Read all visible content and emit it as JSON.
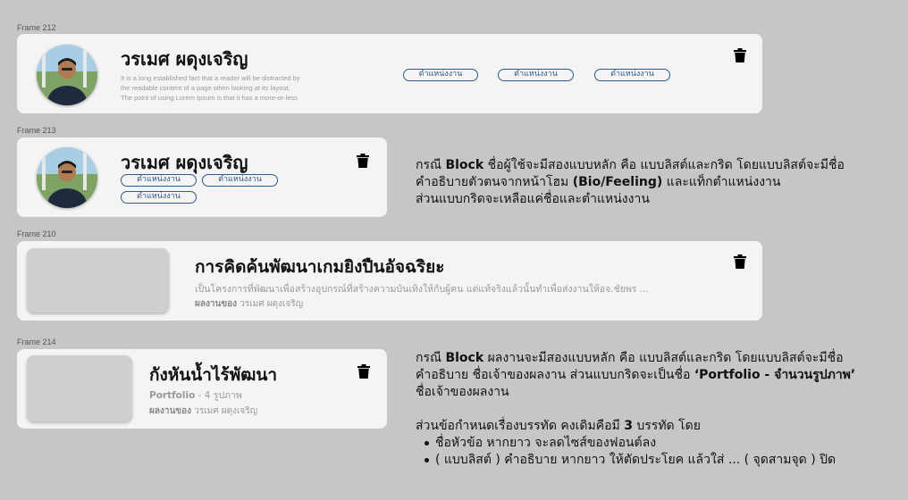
{
  "frames": {
    "f212": "Frame 212",
    "f213": "Frame 213",
    "f210": "Frame 210",
    "f214": "Frame 214"
  },
  "user": {
    "name": "วรเมศ ผดุงเจริญ",
    "bio_line1": "It is a long established fact that a reader will be distracted by",
    "bio_line2": "the readable content of a page when looking at its layout.",
    "bio_line3": "The point of using Lorem Ipsum is that it has a more-or-less",
    "tag": "ตำแหน่งงาน"
  },
  "work_list": {
    "title": "การคิดค้นพัฒนาเกมยิงปืนอัจฉริยะ",
    "description": "เป็นโครงการที่พัฒนาเพื่อสร้างอุปกรณ์ที่สร้างความบันเทิงให้กับผู้คน แต่แท้จริงแล้วนั้นทำเพื่อส่งงานให้อจ.ชัยพร ...",
    "owner_label": "ผลงานของ",
    "owner_name": "วรเมศ ผดุงเจริญ"
  },
  "work_grid": {
    "title": "กังหันน้ำไร้พัฒนา",
    "portfolio_label": "Portfolio",
    "portfolio_count": "- 4 รูปภาพ",
    "owner_label": "ผลงานของ",
    "owner_name": "วรเมศ ผดุงเจริญ"
  },
  "note_user": {
    "l1_a": "กรณี ",
    "l1_b": "Block",
    "l1_c": " ชื่อผู้ใช้จะมีสองแบบหลัก คือ แบบลิสต์และกริด โดยแบบลิสต์จะมีชื่อ",
    "l2_a": "คำอธิบายตัวตนจากหน้าโฮม ",
    "l2_b": "(Bio/Feeling)",
    "l2_c": " และแท็กตำแหน่งงาน",
    "l3": "ส่วนแบบกริดจะเหลือแค่ชื่อและตำแหน่งงาน"
  },
  "note_work": {
    "l1_a": "กรณี ",
    "l1_b": "Block",
    "l1_c": " ผลงานจะมีสองแบบหลัก คือ แบบลิสต์และกริด โดยแบบลิสต์จะมีชื่อ",
    "l2_a": "คำอธิบาย ชื่อเจ้าของผลงาน ส่วนแบบกริดจะเป็นชื่อ ",
    "l2_b": "‘Portfolio - จำนวนรูปภาพ’",
    "l3": "ชื่อเจ้าของผลงาน",
    "l4_a": "ส่วนข้อกำหนดเรื่องบรรทัด คงเดิมคือมี ",
    "l4_b": "3",
    "l4_c": " บรรทัด โดย",
    "b1": "ชื่อหัวข้อ หากยาว จะลดไซส์ของฟอนต์ลง",
    "b2": "( แบบลิสต์ ) คำอธิบาย หากยาว ให้ตัดประโยค แล้วใส่ ... ( จุดสามจุด ) ปิด"
  },
  "icons": {
    "delete": "trash-icon",
    "avatar": "user-photo"
  },
  "colors": {
    "background": "#c6c6c6",
    "card": "#f4f4f4",
    "tag_border": "#2e5a8c",
    "muted_text": "#9a9a9a"
  }
}
